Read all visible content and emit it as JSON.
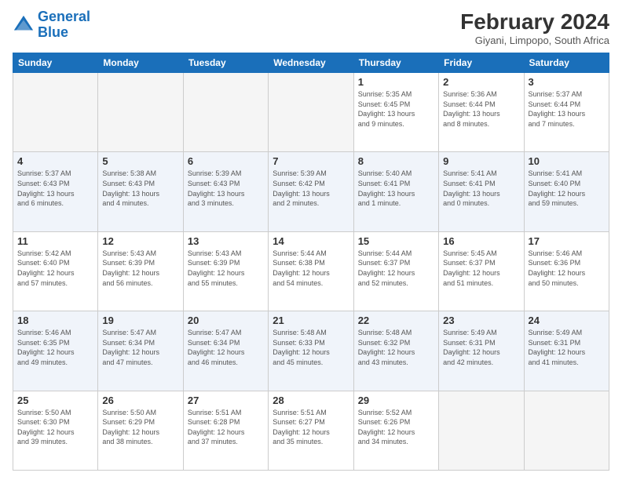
{
  "logo": {
    "line1": "General",
    "line2": "Blue"
  },
  "title": "February 2024",
  "subtitle": "Giyani, Limpopo, South Africa",
  "days_header": [
    "Sunday",
    "Monday",
    "Tuesday",
    "Wednesday",
    "Thursday",
    "Friday",
    "Saturday"
  ],
  "weeks": [
    [
      {
        "num": "",
        "info": "",
        "empty": true
      },
      {
        "num": "",
        "info": "",
        "empty": true
      },
      {
        "num": "",
        "info": "",
        "empty": true
      },
      {
        "num": "",
        "info": "",
        "empty": true
      },
      {
        "num": "1",
        "info": "Sunrise: 5:35 AM\nSunset: 6:45 PM\nDaylight: 13 hours\nand 9 minutes.",
        "empty": false
      },
      {
        "num": "2",
        "info": "Sunrise: 5:36 AM\nSunset: 6:44 PM\nDaylight: 13 hours\nand 8 minutes.",
        "empty": false
      },
      {
        "num": "3",
        "info": "Sunrise: 5:37 AM\nSunset: 6:44 PM\nDaylight: 13 hours\nand 7 minutes.",
        "empty": false
      }
    ],
    [
      {
        "num": "4",
        "info": "Sunrise: 5:37 AM\nSunset: 6:43 PM\nDaylight: 13 hours\nand 6 minutes.",
        "empty": false
      },
      {
        "num": "5",
        "info": "Sunrise: 5:38 AM\nSunset: 6:43 PM\nDaylight: 13 hours\nand 4 minutes.",
        "empty": false
      },
      {
        "num": "6",
        "info": "Sunrise: 5:39 AM\nSunset: 6:43 PM\nDaylight: 13 hours\nand 3 minutes.",
        "empty": false
      },
      {
        "num": "7",
        "info": "Sunrise: 5:39 AM\nSunset: 6:42 PM\nDaylight: 13 hours\nand 2 minutes.",
        "empty": false
      },
      {
        "num": "8",
        "info": "Sunrise: 5:40 AM\nSunset: 6:41 PM\nDaylight: 13 hours\nand 1 minute.",
        "empty": false
      },
      {
        "num": "9",
        "info": "Sunrise: 5:41 AM\nSunset: 6:41 PM\nDaylight: 13 hours\nand 0 minutes.",
        "empty": false
      },
      {
        "num": "10",
        "info": "Sunrise: 5:41 AM\nSunset: 6:40 PM\nDaylight: 12 hours\nand 59 minutes.",
        "empty": false
      }
    ],
    [
      {
        "num": "11",
        "info": "Sunrise: 5:42 AM\nSunset: 6:40 PM\nDaylight: 12 hours\nand 57 minutes.",
        "empty": false
      },
      {
        "num": "12",
        "info": "Sunrise: 5:43 AM\nSunset: 6:39 PM\nDaylight: 12 hours\nand 56 minutes.",
        "empty": false
      },
      {
        "num": "13",
        "info": "Sunrise: 5:43 AM\nSunset: 6:39 PM\nDaylight: 12 hours\nand 55 minutes.",
        "empty": false
      },
      {
        "num": "14",
        "info": "Sunrise: 5:44 AM\nSunset: 6:38 PM\nDaylight: 12 hours\nand 54 minutes.",
        "empty": false
      },
      {
        "num": "15",
        "info": "Sunrise: 5:44 AM\nSunset: 6:37 PM\nDaylight: 12 hours\nand 52 minutes.",
        "empty": false
      },
      {
        "num": "16",
        "info": "Sunrise: 5:45 AM\nSunset: 6:37 PM\nDaylight: 12 hours\nand 51 minutes.",
        "empty": false
      },
      {
        "num": "17",
        "info": "Sunrise: 5:46 AM\nSunset: 6:36 PM\nDaylight: 12 hours\nand 50 minutes.",
        "empty": false
      }
    ],
    [
      {
        "num": "18",
        "info": "Sunrise: 5:46 AM\nSunset: 6:35 PM\nDaylight: 12 hours\nand 49 minutes.",
        "empty": false
      },
      {
        "num": "19",
        "info": "Sunrise: 5:47 AM\nSunset: 6:34 PM\nDaylight: 12 hours\nand 47 minutes.",
        "empty": false
      },
      {
        "num": "20",
        "info": "Sunrise: 5:47 AM\nSunset: 6:34 PM\nDaylight: 12 hours\nand 46 minutes.",
        "empty": false
      },
      {
        "num": "21",
        "info": "Sunrise: 5:48 AM\nSunset: 6:33 PM\nDaylight: 12 hours\nand 45 minutes.",
        "empty": false
      },
      {
        "num": "22",
        "info": "Sunrise: 5:48 AM\nSunset: 6:32 PM\nDaylight: 12 hours\nand 43 minutes.",
        "empty": false
      },
      {
        "num": "23",
        "info": "Sunrise: 5:49 AM\nSunset: 6:31 PM\nDaylight: 12 hours\nand 42 minutes.",
        "empty": false
      },
      {
        "num": "24",
        "info": "Sunrise: 5:49 AM\nSunset: 6:31 PM\nDaylight: 12 hours\nand 41 minutes.",
        "empty": false
      }
    ],
    [
      {
        "num": "25",
        "info": "Sunrise: 5:50 AM\nSunset: 6:30 PM\nDaylight: 12 hours\nand 39 minutes.",
        "empty": false
      },
      {
        "num": "26",
        "info": "Sunrise: 5:50 AM\nSunset: 6:29 PM\nDaylight: 12 hours\nand 38 minutes.",
        "empty": false
      },
      {
        "num": "27",
        "info": "Sunrise: 5:51 AM\nSunset: 6:28 PM\nDaylight: 12 hours\nand 37 minutes.",
        "empty": false
      },
      {
        "num": "28",
        "info": "Sunrise: 5:51 AM\nSunset: 6:27 PM\nDaylight: 12 hours\nand 35 minutes.",
        "empty": false
      },
      {
        "num": "29",
        "info": "Sunrise: 5:52 AM\nSunset: 6:26 PM\nDaylight: 12 hours\nand 34 minutes.",
        "empty": false
      },
      {
        "num": "",
        "info": "",
        "empty": true
      },
      {
        "num": "",
        "info": "",
        "empty": true
      }
    ]
  ]
}
